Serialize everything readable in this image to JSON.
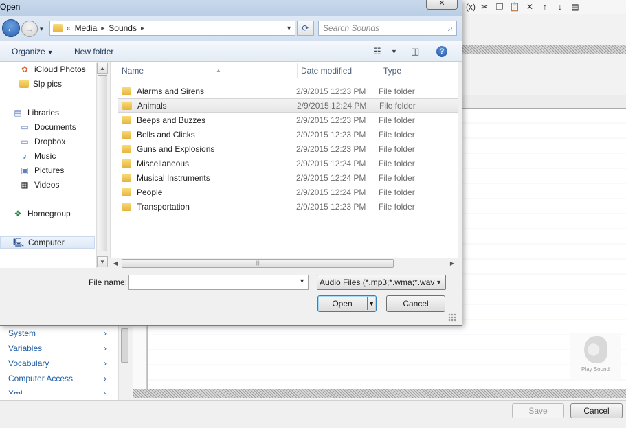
{
  "dialog": {
    "title": "Open",
    "close_icon": "✕",
    "nav": {
      "back_icon": "←",
      "forward_icon": "→",
      "recent_icon": "▾"
    },
    "breadcrumbs": [
      "Media",
      "Sounds"
    ],
    "breadcrumb_overflow": "«",
    "search": {
      "placeholder": "Search Sounds",
      "value": ""
    },
    "toolbar": {
      "organize": "Organize",
      "new_folder": "New folder"
    },
    "nav_pane": [
      {
        "label": "iCloud Photos",
        "icon": "photos-icon"
      },
      {
        "label": "Slp pics",
        "icon": "folder-icon"
      },
      {
        "label": "Libraries",
        "icon": "libraries-icon"
      },
      {
        "label": "Documents",
        "icon": "documents-icon"
      },
      {
        "label": "Dropbox",
        "icon": "dropbox-icon"
      },
      {
        "label": "Music",
        "icon": "music-icon"
      },
      {
        "label": "Pictures",
        "icon": "pictures-icon"
      },
      {
        "label": "Videos",
        "icon": "videos-icon"
      },
      {
        "label": "Homegroup",
        "icon": "homegroup-icon"
      },
      {
        "label": "Computer",
        "icon": "computer-icon"
      }
    ],
    "columns": {
      "name": "Name",
      "date": "Date modified",
      "type": "Type"
    },
    "files": [
      {
        "name": "Alarms and Sirens",
        "date": "2/9/2015 12:23 PM",
        "type": "File folder"
      },
      {
        "name": "Animals",
        "date": "2/9/2015 12:24 PM",
        "type": "File folder"
      },
      {
        "name": "Beeps and Buzzes",
        "date": "2/9/2015 12:23 PM",
        "type": "File folder"
      },
      {
        "name": "Bells and Clicks",
        "date": "2/9/2015 12:23 PM",
        "type": "File folder"
      },
      {
        "name": "Guns and Explosions",
        "date": "2/9/2015 12:23 PM",
        "type": "File folder"
      },
      {
        "name": "Miscellaneous",
        "date": "2/9/2015 12:24 PM",
        "type": "File folder"
      },
      {
        "name": "Musical Instruments",
        "date": "2/9/2015 12:24 PM",
        "type": "File folder"
      },
      {
        "name": "People",
        "date": "2/9/2015 12:24 PM",
        "type": "File folder"
      },
      {
        "name": "Transportation",
        "date": "2/9/2015 12:23 PM",
        "type": "File folder"
      }
    ],
    "file_name": {
      "label": "File name:",
      "value": ""
    },
    "filter": "Audio Files (*.mp3;*.wma;*.wav",
    "buttons": {
      "open": "Open",
      "cancel": "Cancel"
    }
  },
  "background_app": {
    "toolbar_text": "(x)",
    "left_list": [
      "System",
      "Variables",
      "Vocabulary",
      "Computer Access",
      "Xml"
    ],
    "play_sound": "Play Sound",
    "buttons": {
      "save": "Save",
      "cancel": "Cancel"
    }
  },
  "colors": {
    "title_bar": "#c9d9ec",
    "link": "#1f5fa8",
    "folder": "#e6b23c"
  }
}
